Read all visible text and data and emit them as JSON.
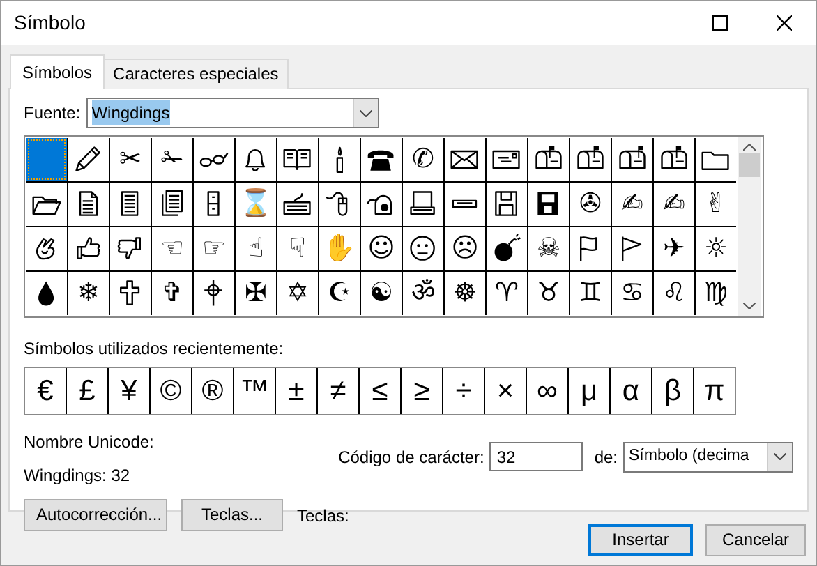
{
  "window": {
    "title": "Símbolo"
  },
  "tabs": [
    {
      "label": "Símbolos",
      "selected": true
    },
    {
      "label": "Caracteres especiales",
      "selected": false
    }
  ],
  "font": {
    "label": "Fuente:",
    "value": "Wingdings",
    "text_selected": true
  },
  "symbol_grid": [
    {
      "kind": "blank",
      "selected": true
    },
    {
      "kind": "icon",
      "selected": false
    },
    {
      "kind": "glyph",
      "text": "✂",
      "selected": false
    },
    {
      "kind": "glyph",
      "text": "✁",
      "selected": false
    },
    {
      "kind": "icon",
      "selected": false
    },
    {
      "kind": "icon",
      "selected": false
    },
    {
      "kind": "icon",
      "selected": false
    },
    {
      "kind": "icon",
      "selected": false
    },
    {
      "kind": "icon",
      "selected": false
    },
    {
      "kind": "glyph",
      "text": "✆",
      "selected": false
    },
    {
      "kind": "icon",
      "selected": false
    },
    {
      "kind": "icon",
      "selected": false
    },
    {
      "kind": "icon",
      "selected": false
    },
    {
      "kind": "icon",
      "selected": false
    },
    {
      "kind": "icon",
      "selected": false
    },
    {
      "kind": "icon",
      "selected": false
    },
    {
      "kind": "icon",
      "selected": false
    },
    {
      "kind": "icon",
      "selected": false
    },
    {
      "kind": "icon",
      "selected": false
    },
    {
      "kind": "icon",
      "selected": false
    },
    {
      "kind": "icon",
      "selected": false
    },
    {
      "kind": "icon",
      "selected": false
    },
    {
      "kind": "glyph",
      "text": "⌛",
      "selected": false
    },
    {
      "kind": "icon",
      "selected": false
    },
    {
      "kind": "icon",
      "selected": false
    },
    {
      "kind": "icon",
      "selected": false
    },
    {
      "kind": "icon",
      "selected": false
    },
    {
      "kind": "icon",
      "selected": false
    },
    {
      "kind": "icon",
      "selected": false
    },
    {
      "kind": "icon",
      "selected": false
    },
    {
      "kind": "glyph",
      "text": "✇",
      "selected": false
    },
    {
      "kind": "glyph",
      "text": "✍",
      "selected": false
    },
    {
      "kind": "glyph",
      "text": "✍",
      "selected": false
    },
    {
      "kind": "glyph",
      "text": "✌",
      "selected": false
    },
    {
      "kind": "icon",
      "selected": false
    },
    {
      "kind": "icon",
      "selected": false
    },
    {
      "kind": "icon",
      "selected": false
    },
    {
      "kind": "glyph",
      "text": "☜",
      "selected": false
    },
    {
      "kind": "glyph",
      "text": "☞",
      "selected": false
    },
    {
      "kind": "glyph",
      "text": "☝",
      "selected": false
    },
    {
      "kind": "glyph",
      "text": "☟",
      "selected": false
    },
    {
      "kind": "glyph",
      "text": "✋",
      "selected": false
    },
    {
      "kind": "glyph",
      "text": "☺",
      "selected": false
    },
    {
      "kind": "icon",
      "selected": false
    },
    {
      "kind": "glyph",
      "text": "☹",
      "selected": false
    },
    {
      "kind": "icon",
      "selected": false
    },
    {
      "kind": "glyph",
      "text": "☠",
      "selected": false
    },
    {
      "kind": "icon",
      "selected": false
    },
    {
      "kind": "icon",
      "selected": false
    },
    {
      "kind": "glyph",
      "text": "✈",
      "selected": false
    },
    {
      "kind": "glyph",
      "text": "☼",
      "selected": false
    },
    {
      "kind": "icon",
      "selected": false
    },
    {
      "kind": "glyph",
      "text": "❄",
      "selected": false
    },
    {
      "kind": "icon",
      "selected": false
    },
    {
      "kind": "glyph",
      "text": "✞",
      "selected": false
    },
    {
      "kind": "icon",
      "selected": false
    },
    {
      "kind": "glyph",
      "text": "✠",
      "selected": false
    },
    {
      "kind": "glyph",
      "text": "✡",
      "selected": false
    },
    {
      "kind": "glyph",
      "text": "☪",
      "selected": false
    },
    {
      "kind": "glyph",
      "text": "☯",
      "selected": false
    },
    {
      "kind": "glyph",
      "text": "ॐ",
      "selected": false
    },
    {
      "kind": "glyph",
      "text": "☸",
      "selected": false
    },
    {
      "kind": "glyph",
      "text": "♈",
      "selected": false
    },
    {
      "kind": "glyph",
      "text": "♉",
      "selected": false
    },
    {
      "kind": "glyph",
      "text": "♊",
      "selected": false
    },
    {
      "kind": "glyph",
      "text": "♋",
      "selected": false
    },
    {
      "kind": "glyph",
      "text": "♌",
      "selected": false
    },
    {
      "kind": "glyph",
      "text": "♍",
      "selected": false
    }
  ],
  "recent": {
    "label": "Símbolos utilizados recientemente:",
    "symbols": [
      "€",
      "£",
      "¥",
      "©",
      "®",
      "™",
      "±",
      "≠",
      "≤",
      "≥",
      "÷",
      "×",
      "∞",
      "μ",
      "α",
      "β",
      "π"
    ]
  },
  "unicode_name": {
    "label": "Nombre Unicode:",
    "value": "Wingdings: 32"
  },
  "char_code": {
    "label": "Código de carácter:",
    "value": "32"
  },
  "from": {
    "label": "de:",
    "value": "Símbolo (decima"
  },
  "buttons": [
    {
      "label": "Autocorrección..."
    },
    {
      "label": "Teclas..."
    }
  ],
  "shortcut_label": "Teclas:",
  "dialog_buttons": [
    {
      "label": "Insertar",
      "default": true
    },
    {
      "label": "Cancelar",
      "default": false
    }
  ]
}
